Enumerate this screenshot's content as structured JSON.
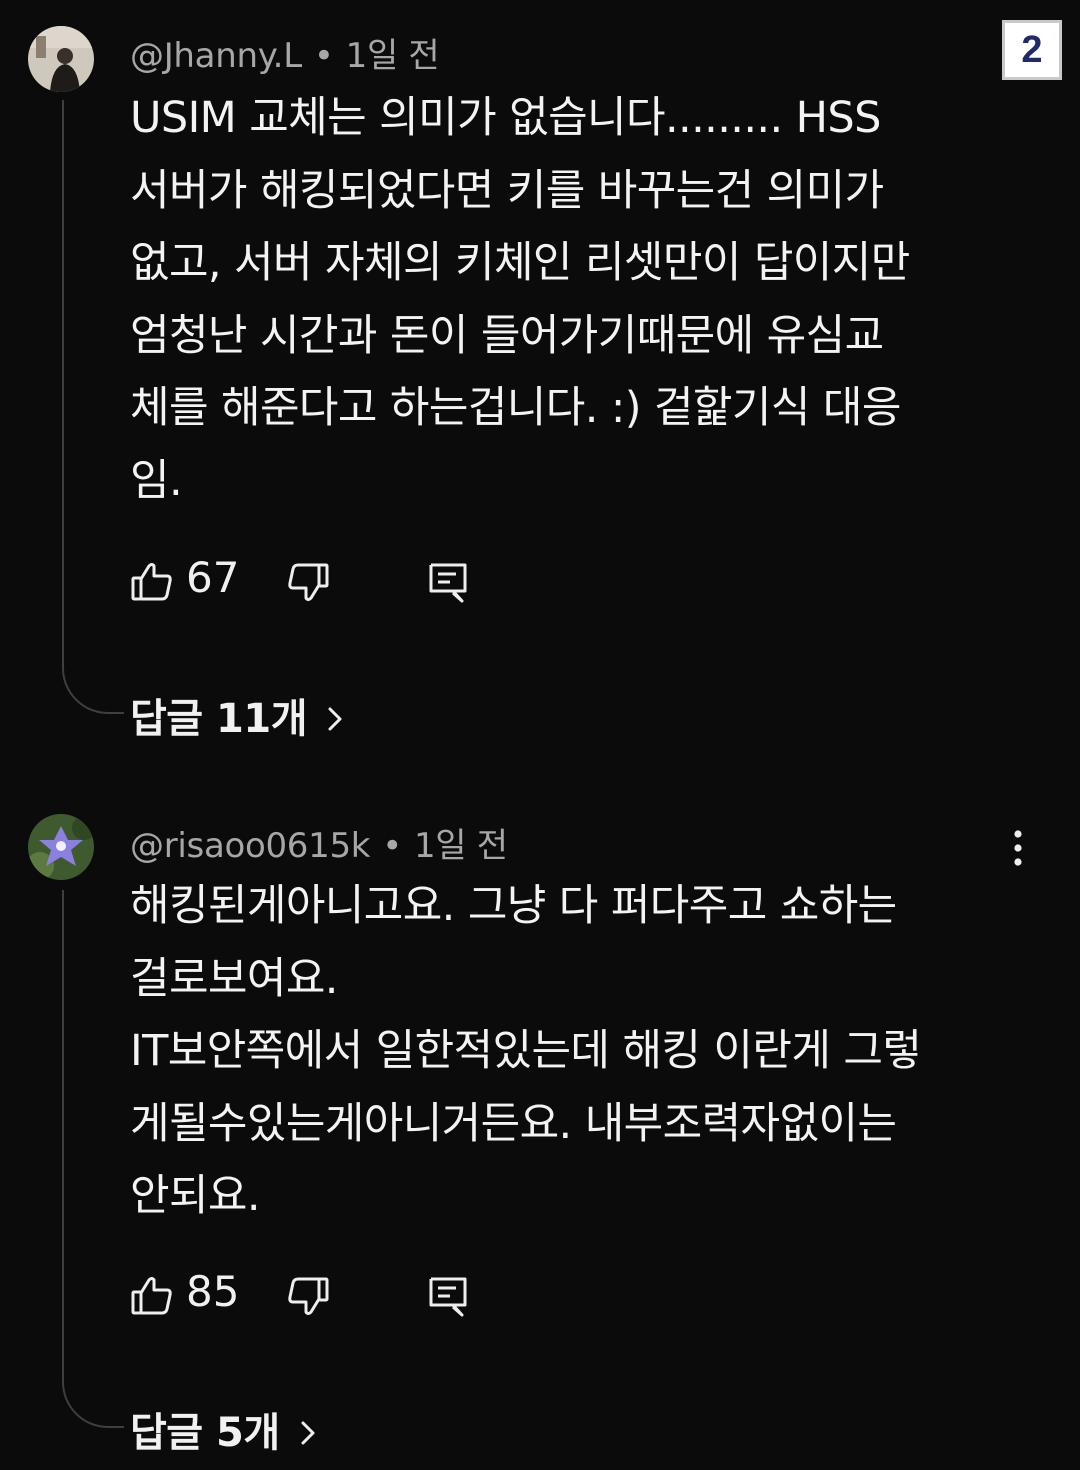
{
  "page_badge": "2",
  "comments": [
    {
      "author": "@Jhanny.L",
      "separator": "•",
      "time": "1일 전",
      "lines": [
        "USIM 교체는 의미가 없습니다......... HSS",
        "서버가 해킹되었다면 키를 바꾸는건 의미가",
        "없고, 서버 자체의 키체인 리셋만이 답이지만",
        "엄청난 시간과 돈이 들어가기때문에 유심교",
        "체를 해준다고 하는겁니다. :) 겉핥기식 대응",
        "임."
      ],
      "likes": "67",
      "replies_label": "답글 11개",
      "avatar_colors": [
        "#c9c2b6",
        "#2b2622"
      ]
    },
    {
      "author": "@risaoo0615k",
      "separator": "•",
      "time": "1일 전",
      "lines": [
        "해킹된게아니고요. 그냥 다 퍼다주고 쇼하는",
        "걸로보여요.",
        "IT보안쪽에서 일한적있는데 해킹 이란게 그렇",
        "게될수있는게아니거든요. 내부조력자없이는",
        "안되요."
      ],
      "likes": "85",
      "replies_label": "답글 5개",
      "avatar_colors": [
        "#4f6b3a",
        "#7a6fd0"
      ]
    }
  ],
  "icons": {
    "like": "thumb-up-icon",
    "dislike": "thumb-down-icon",
    "reply": "comment-icon",
    "more": "more-vert-icon",
    "chevron": "chevron-right-icon"
  }
}
